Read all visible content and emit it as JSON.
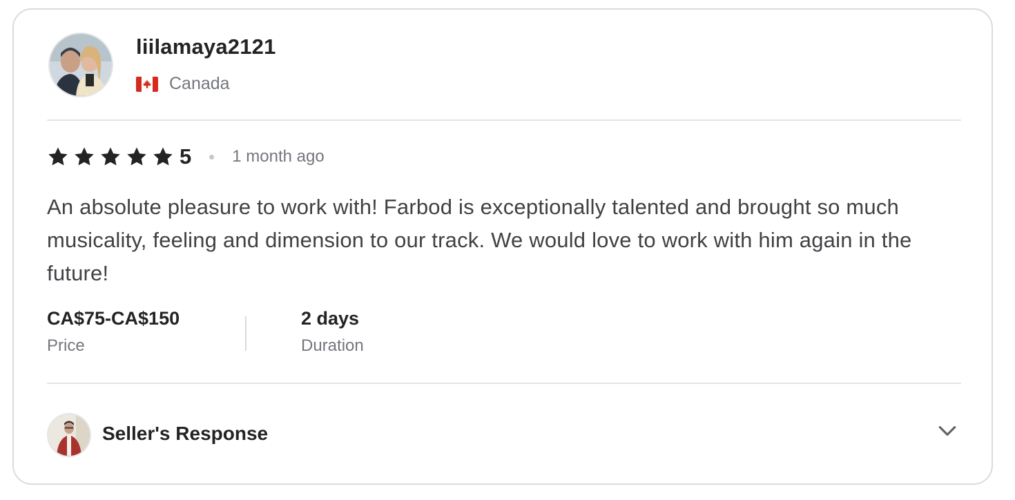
{
  "review": {
    "username": "liilamaya2121",
    "country": "Canada",
    "flag_icon": "canada-flag-icon",
    "rating": {
      "stars": 5,
      "value": "5",
      "star_icon": "star-icon",
      "star_color": "#222325"
    },
    "time_ago": "1 month ago",
    "text": "An absolute pleasure to work with! Farbod is exceptionally talented and brought so much musicality, feeling and dimension to our track. We would love to work with him again in the future!",
    "price": {
      "value": "CA$75-CA$150",
      "label": "Price"
    },
    "duration": {
      "value": "2 days",
      "label": "Duration"
    }
  },
  "seller_response": {
    "label": "Seller's Response",
    "toggle_icon": "chevron-down-icon"
  },
  "colors": {
    "text_primary": "#222325",
    "text_secondary": "#74767e",
    "border": "#dadbdd",
    "flag_red": "#d52b1e"
  }
}
